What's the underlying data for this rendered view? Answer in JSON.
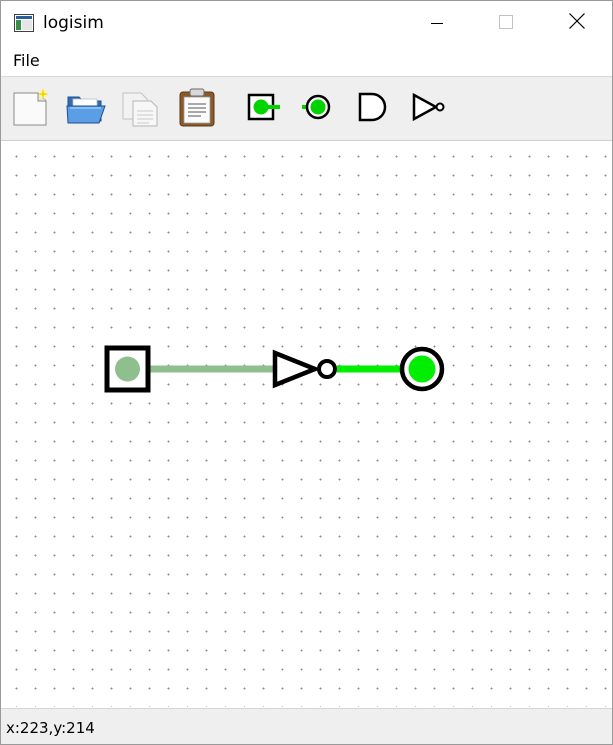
{
  "window": {
    "title": "logisim",
    "controls": [
      "minimize-icon",
      "maximize-icon",
      "close-icon"
    ]
  },
  "menubar": {
    "items": [
      {
        "label": "File"
      }
    ]
  },
  "toolbar": {
    "tools": [
      {
        "icon": "new-file-icon"
      },
      {
        "icon": "open-folder-icon"
      },
      {
        "icon": "copy-icon"
      },
      {
        "icon": "paste-clipboard-icon"
      },
      {
        "icon": "input-pin-icon"
      },
      {
        "icon": "output-pin-icon"
      },
      {
        "icon": "and-gate-icon"
      },
      {
        "icon": "not-gate-icon"
      }
    ]
  },
  "circuit": {
    "components": [
      {
        "type": "input-pin",
        "state": "off"
      },
      {
        "type": "not-gate"
      },
      {
        "type": "output-pin",
        "state": "on"
      }
    ],
    "wires": [
      {
        "from": "input-pin",
        "to": "not-gate",
        "state": "off"
      },
      {
        "from": "not-gate",
        "to": "output-pin",
        "state": "on"
      }
    ],
    "colors": {
      "wire_off": "#8fbf8f",
      "wire_on": "#00ee00",
      "outline": "#000000"
    }
  },
  "status": {
    "coords": "x:223,y:214"
  }
}
